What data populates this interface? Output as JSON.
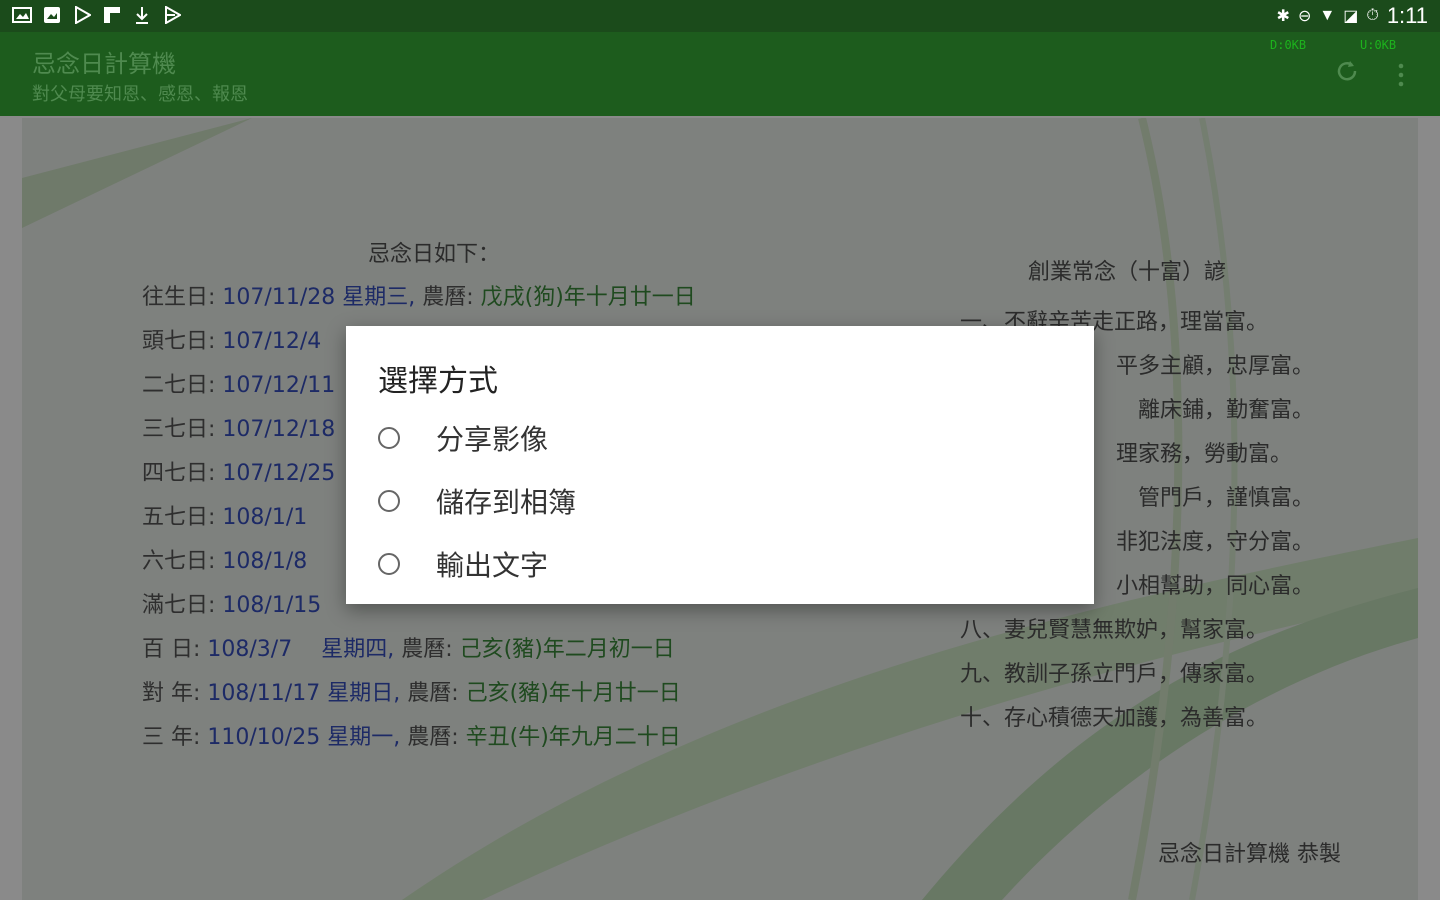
{
  "status_bar": {
    "left_icons": [
      "gallery-icon",
      "image-icon",
      "play-store-icon",
      "flipboard-icon",
      "download-icon",
      "play-icon"
    ],
    "right_icons": [
      "bluetooth-icon",
      "do-not-disturb-icon",
      "wifi-icon",
      "no-sim-icon",
      "alarm-icon"
    ],
    "time": "1:11"
  },
  "toolbar": {
    "title": "忌念日計算機",
    "subtitle": "對父母要知恩、感恩、報恩",
    "download_speed": "D:0KB",
    "upload_speed": "U:0KB"
  },
  "content": {
    "left_title": "忌念日如下：",
    "rows": [
      {
        "label": "往生日:",
        "date": "107/11/28 星期三,",
        "lunar_prefix": "農曆:",
        "lunar": "戊戌(狗)年十月廿一日"
      },
      {
        "label": "頭七日:",
        "date": "107/12/4",
        "lunar_prefix": "",
        "lunar": ""
      },
      {
        "label": "二七日:",
        "date": "107/12/11",
        "lunar_prefix": "",
        "lunar": ""
      },
      {
        "label": "三七日:",
        "date": "107/12/18",
        "lunar_prefix": "",
        "lunar": ""
      },
      {
        "label": "四七日:",
        "date": "107/12/25",
        "lunar_prefix": "",
        "lunar": ""
      },
      {
        "label": "五七日:",
        "date": "108/1/1",
        "lunar_prefix": "",
        "lunar": ""
      },
      {
        "label": "六七日:",
        "date": "108/1/8",
        "lunar_prefix": "",
        "lunar": ""
      },
      {
        "label": "滿七日:",
        "date": "108/1/15",
        "lunar_prefix": "",
        "lunar": ""
      },
      {
        "label": "百 日:",
        "date": "108/3/7　 星期四,",
        "lunar_prefix": "農曆:",
        "lunar": "己亥(豬)年二月初一日"
      },
      {
        "label": "對 年:",
        "date": "108/11/17 星期日,",
        "lunar_prefix": "農曆:",
        "lunar": "己亥(豬)年十月廿一日"
      },
      {
        "label": "三 年:",
        "date": "110/10/25 星期一,",
        "lunar_prefix": "農曆:",
        "lunar": "辛丑(牛)年九月二十日"
      }
    ],
    "right_title": "創業常念（十富）諺",
    "sayings": [
      "一、不辭辛苦走正路，理當富。",
      "平多主顧，忠厚富。",
      "離床鋪，勤奮富。",
      "理家務，勞動富。",
      "管門戶，謹慎富。",
      "非犯法度，守分富。",
      "小相幫助，同心富。",
      "八、妻兒賢慧無欺妒，幫家富。",
      "九、教訓子孫立門戶，傳家富。",
      "十、存心積德天加護，為善富。"
    ],
    "footer": "忌念日計算機 恭製"
  },
  "dialog": {
    "title": "選擇方式",
    "options": [
      "分享影像",
      "儲存到相簿",
      "輸出文字"
    ]
  }
}
